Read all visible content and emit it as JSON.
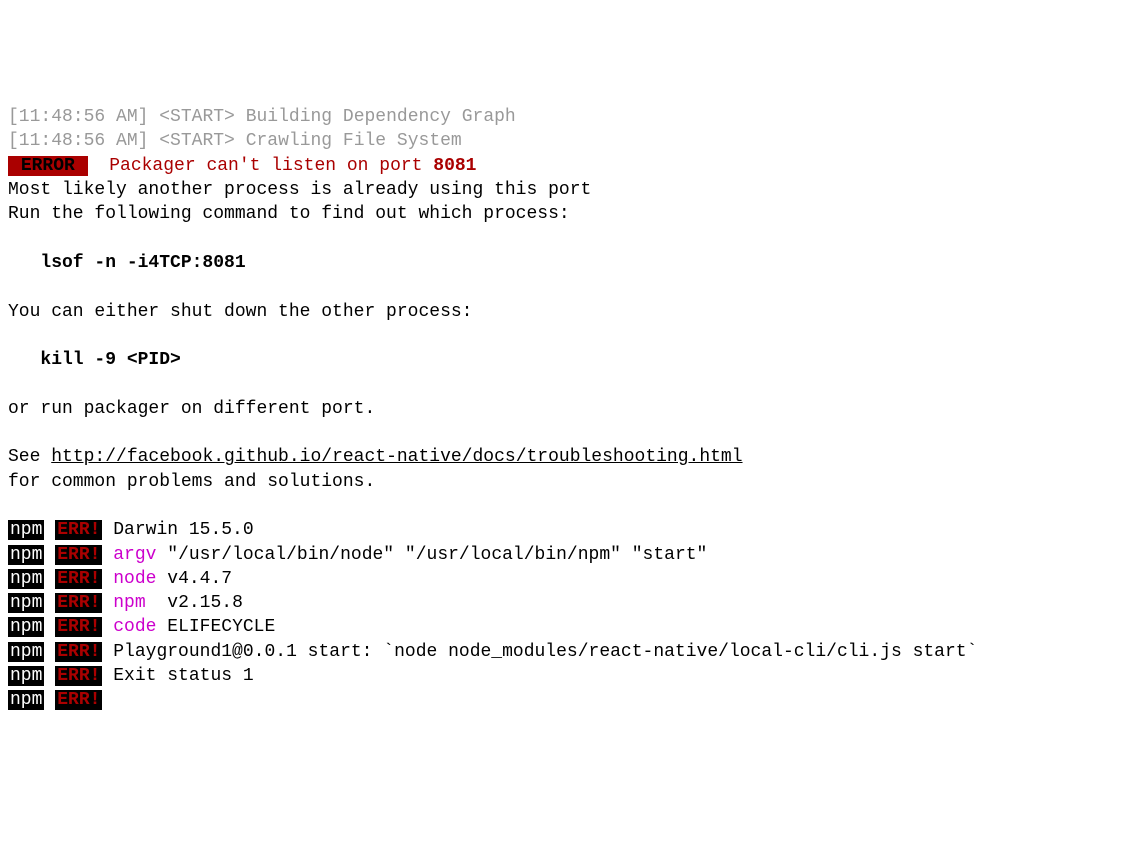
{
  "log1": {
    "ts": "[11:48:56 AM]",
    "tag": "<START>",
    "msg": "Building Dependency Graph"
  },
  "log2": {
    "ts": "[11:48:56 AM]",
    "tag": "<START>",
    "msg": "Crawling File System"
  },
  "error_badge": " ERROR ",
  "error_msg": "  Packager can't listen on port ",
  "error_port": "8081",
  "txt1": "Most likely another process is already using this port",
  "txt2": "Run the following command to find out which process:",
  "lsof_cmd": "   lsof -n -i4TCP:8081",
  "txt3": "You can either shut down the other process:",
  "kill_cmd": "   kill -9 <PID>",
  "txt4": "or run packager on different port.",
  "see_prefix": "See ",
  "see_url": "http://facebook.github.io/react-native/docs/troubleshooting.html",
  "txt5": "for common problems and solutions.",
  "npm_label": "npm",
  "err_label": "ERR!",
  "npm1_msg": " Darwin 15.5.0",
  "npm2_key": "argv",
  "npm2_val": " \"/usr/local/bin/node\" \"/usr/local/bin/npm\" \"start\"",
  "npm3_key": "node",
  "npm3_val": " v4.4.7",
  "npm4_key": "npm ",
  "npm4_val": " v2.15.8",
  "npm5_key": "code",
  "npm5_val": " ELIFECYCLE",
  "npm6_msg": " Playground1@0.0.1 start: `node node_modules/react-native/local-cli/cli.js start`",
  "npm7_msg": " Exit status 1"
}
